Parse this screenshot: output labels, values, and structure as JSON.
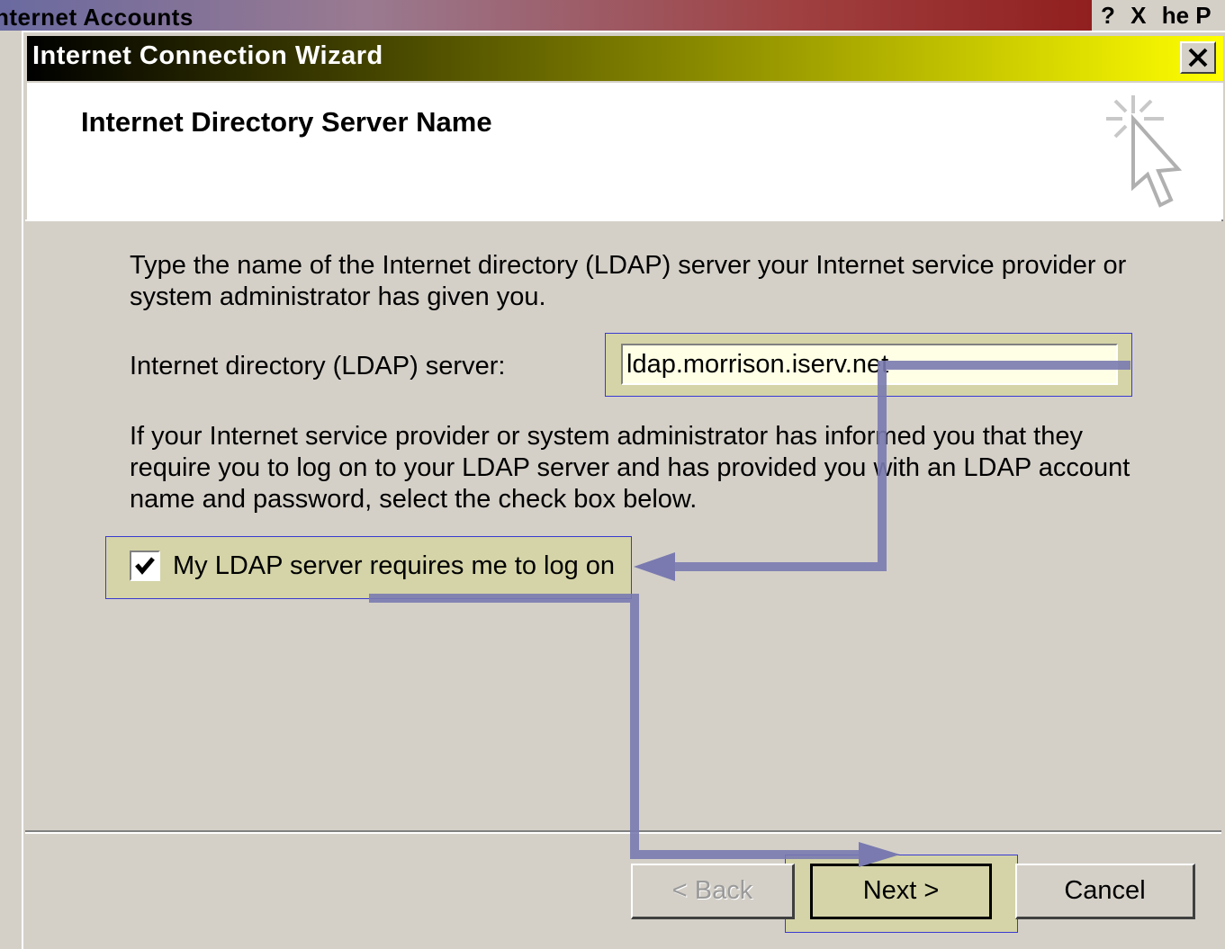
{
  "parent_window": {
    "title": "nternet Accounts",
    "controls": [
      "?",
      "X",
      "he P"
    ]
  },
  "dialog": {
    "title": "Internet Connection Wizard",
    "close_label": "×"
  },
  "header": {
    "title": "Internet Directory Server Name",
    "icon": "wizard-cursor-icon"
  },
  "body": {
    "description_line1": "Type the name of the Internet directory (LDAP) server your Internet service provider or",
    "description_line2": "system administrator has given you.",
    "server_label": "Internet directory (LDAP) server:",
    "server_value": "ldap.morrison.iserv.net",
    "info_line1": "If your Internet service provider or system administrator has informed you that they",
    "info_line2": "require you to log on to your LDAP server and has provided you with an LDAP account",
    "info_line3": "name and password, select the check box below.",
    "checkbox_label": "My LDAP server requires me to log on",
    "checkbox_checked": true
  },
  "buttons": {
    "back": "< Back",
    "next": "Next >",
    "cancel": "Cancel"
  },
  "colors": {
    "highlight": "#d4d4a8",
    "highlight_border": "#3a3ad0",
    "arrow": "#7a7ab0",
    "dialog_face": "#d4d0c8"
  }
}
